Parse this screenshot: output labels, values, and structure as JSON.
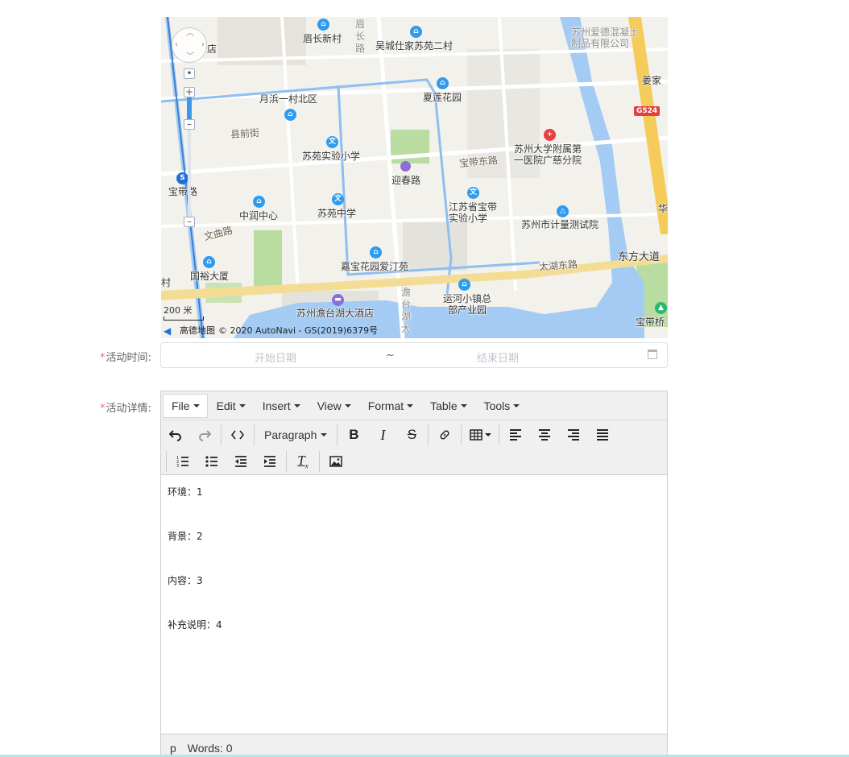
{
  "map": {
    "labels": [
      {
        "text": "眉长新村"
      },
      {
        "text": "吴城仕家苏苑二村"
      },
      {
        "text": "苏州爱德混凝土制品有限公司"
      },
      {
        "text": "姜家"
      },
      {
        "text": "月浜一村北区"
      },
      {
        "text": "夏莲花园"
      },
      {
        "text": "县前街"
      },
      {
        "text": "苏苑实验小学"
      },
      {
        "text": "苏州大学附属第一医院广慈分院"
      },
      {
        "text": "宝带东路"
      },
      {
        "text": "迎春路"
      },
      {
        "text": "宝带路"
      },
      {
        "text": "中润中心"
      },
      {
        "text": "苏苑中学"
      },
      {
        "text": "江苏省宝带实验小学"
      },
      {
        "text": "苏州市计量测试院"
      },
      {
        "text": "文曲路"
      },
      {
        "text": "嘉宝花园爱汀苑"
      },
      {
        "text": "太湖东路"
      },
      {
        "text": "东方大道"
      },
      {
        "text": "国裕大厦"
      },
      {
        "text": "苏州澹台湖大酒店"
      },
      {
        "text": "澹台湖大"
      },
      {
        "text": "运河小镇总部产业园"
      },
      {
        "text": "宝带桥"
      },
      {
        "text": "店"
      },
      {
        "text": "村"
      },
      {
        "text": "眉长路"
      },
      {
        "text": "华"
      }
    ],
    "highway_shield": "G524",
    "scale_text": "200 米",
    "provider_name": "高德地图",
    "attribution": "© 2020 AutoNavi - GS(2019)6379号"
  },
  "form": {
    "time_label": "活动时间:",
    "detail_label": "活动详情:",
    "required_mark": "*",
    "start_placeholder": "开始日期",
    "range_separator": "~",
    "end_placeholder": "结束日期"
  },
  "editor": {
    "menus": [
      "File",
      "Edit",
      "Insert",
      "View",
      "Format",
      "Table",
      "Tools"
    ],
    "block_format": "Paragraph",
    "content": [
      "环境：1",
      "背景：2",
      "内容：3",
      "补充说明：4"
    ],
    "status_path": "p",
    "word_count": "Words: 0"
  }
}
